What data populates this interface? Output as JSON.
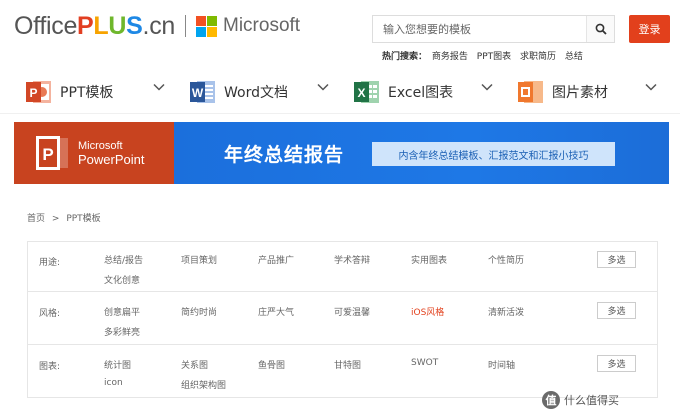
{
  "header": {
    "logo_office": "Office",
    "logo_plus": [
      "P",
      "L",
      "U",
      "S"
    ],
    "logo_cn": ".cn",
    "microsoft": "Microsoft",
    "search_placeholder": "输入您想要的模板",
    "login": "登录",
    "hot_label": "热门搜索：",
    "hot_links": [
      "商务报告",
      "PPT图表",
      "求职简历",
      "总结"
    ]
  },
  "colors": {
    "accent": "#e2401c",
    "plus_colors": [
      "#e23f22",
      "#f7a300",
      "#6fb72c",
      "#1e88e5"
    ],
    "ms_squares": [
      "#f25022",
      "#7fba00",
      "#00a4ef",
      "#ffb900"
    ]
  },
  "categories": [
    {
      "label": "PPT模板",
      "icon": "powerpoint-icon",
      "color": "#d24726",
      "letter": "P"
    },
    {
      "label": "Word文档",
      "icon": "word-icon",
      "color": "#2b579a",
      "letter": "W"
    },
    {
      "label": "Excel图表",
      "icon": "excel-icon",
      "color": "#217346",
      "letter": "X"
    },
    {
      "label": "图片素材",
      "icon": "image-icon",
      "color": "#f0782e",
      "letter": ""
    }
  ],
  "banner": {
    "brand_line1": "Microsoft",
    "brand_line2": "PowerPoint",
    "title": "年终总结报告",
    "subtitle": "内含年终总结模板、汇报范文和汇报小技巧"
  },
  "breadcrumb": {
    "home": "首页",
    "sep": ">",
    "current": "PPT模板"
  },
  "filters": {
    "multi_label": "多选",
    "rows": [
      {
        "label": "用途:",
        "options": [
          "总结/报告",
          "项目策划",
          "产品推广",
          "学术答辩",
          "实用图表",
          "个性简历",
          "文化创意"
        ]
      },
      {
        "label": "风格:",
        "options": [
          "创意扁平",
          "简约时尚",
          "庄严大气",
          "可爱温馨",
          "iOS风格",
          "清新活泼",
          "多彩鲜亮"
        ],
        "active": "iOS风格"
      },
      {
        "label": "图表:",
        "options": [
          "统计图",
          "关系图",
          "鱼骨图",
          "甘特图",
          "SWOT",
          "时间轴",
          "icon",
          "组织架构图"
        ]
      }
    ]
  },
  "watermark": {
    "badge": "值",
    "text": "什么值得买"
  }
}
